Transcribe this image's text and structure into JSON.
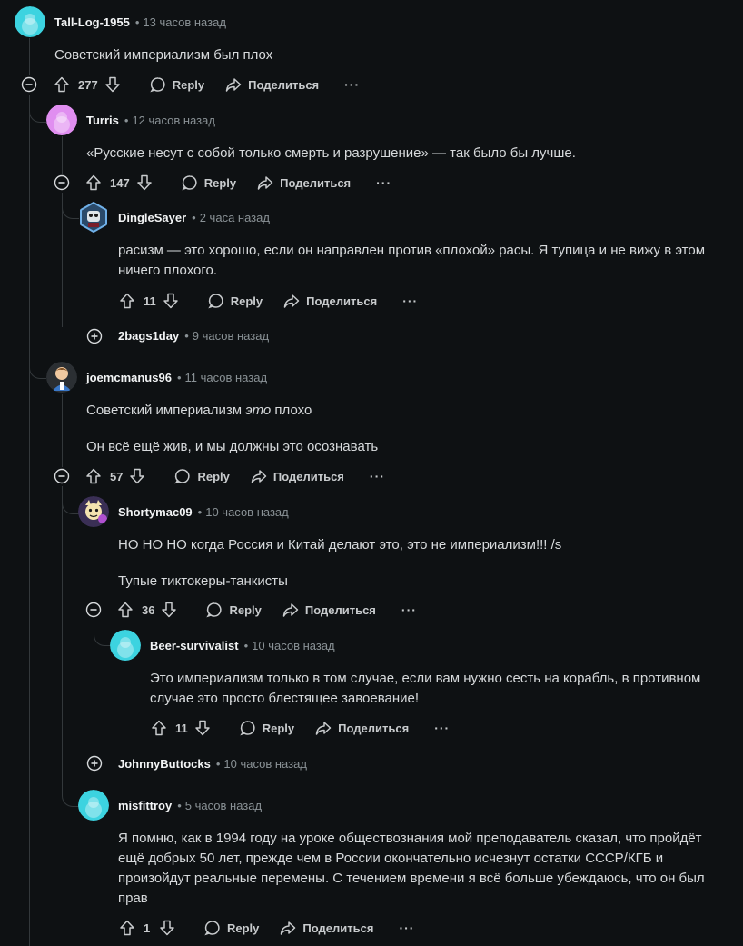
{
  "actions": {
    "reply": "Reply",
    "share": "Поделиться",
    "more": "···"
  },
  "comments": [
    {
      "author": "Tall-Log-1955",
      "time": "13 часов назад",
      "body": [
        "Советский империализм был плох"
      ],
      "votes": "277"
    },
    {
      "author": "Turris",
      "time": "12 часов назад",
      "body": [
        "«Русские несут с собой только смерть и разрушение» — так было бы лучше."
      ],
      "votes": "147"
    },
    {
      "author": "DingleSayer",
      "time": "2 часа назад",
      "body": [
        "расизм — это хорошо, если он направлен против «плохой» расы. Я тупица и не вижу в этом",
        "ничего плохого."
      ],
      "votes": "11"
    },
    {
      "author": "2bags1day",
      "time": "9 часов назад",
      "collapsed": true
    },
    {
      "author": "joemcmanus96",
      "time": "11 часов назад",
      "body_pre": "Советский империализм ",
      "body_em": "это",
      "body_post": " плохо",
      "body2": "Он всё ещё жив, и мы должны это осознавать",
      "votes": "57"
    },
    {
      "author": "Shortymac09",
      "time": "10 часов назад",
      "body": [
        "НО НО НО когда Россия и Китай делают это, это не империализм!!! /s"
      ],
      "body2": "Тупые тиктокеры-танкисты",
      "votes": "36"
    },
    {
      "author": "Beer-survivalist",
      "time": "10 часов назад",
      "body": [
        "Это империализм только в том случае, если вам нужно сесть на корабль, в противном",
        "случае это просто блестящее завоевание!"
      ],
      "votes": "11"
    },
    {
      "author": "JohnnyButtocks",
      "time": "10 часов назад",
      "collapsed": true
    },
    {
      "author": "misfittroy",
      "time": "5 часов назад",
      "body": [
        "Я помню, как в 1994 году на уроке обществознания мой преподаватель сказал, что пройдёт",
        "ещё добрых 50 лет, прежде чем в России окончательно исчезнут остатки СССР/КГБ и",
        "произойдут реальные перемены. С течением времени я всё больше убеждаюсь, что он был",
        "прав"
      ],
      "votes": "1"
    }
  ],
  "colors": {
    "background": "#0e1113",
    "thread_line": "#33383b",
    "avatar_cyan": "#3cd3e0",
    "avatar_pink": "#e08ef0"
  }
}
